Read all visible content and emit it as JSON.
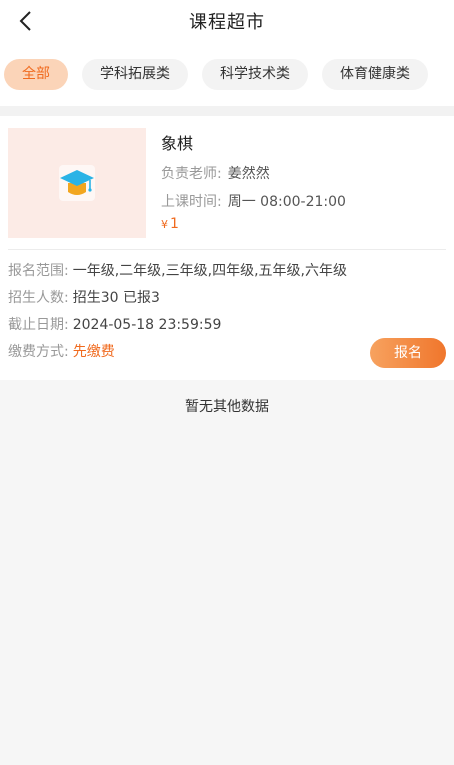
{
  "header": {
    "title": "课程超市",
    "back_icon": "chevron-left-icon"
  },
  "tabs": [
    {
      "label": "全部",
      "active": true
    },
    {
      "label": "学科拓展类",
      "active": false
    },
    {
      "label": "科学技术类",
      "active": false
    },
    {
      "label": "体育健康类",
      "active": false
    }
  ],
  "course": {
    "icon": "graduation-cap-icon",
    "name": "象棋",
    "teacher_label": "负责老师:",
    "teacher": "姜然然",
    "time_label": "上课时间:",
    "time": "周一 08:00-21:00",
    "price_symbol": "¥",
    "price": "1",
    "details": {
      "grades_label": "报名范围:",
      "grades": "一年级,二年级,三年级,四年级,五年级,六年级",
      "enroll_label": "招生人数:",
      "enroll": "招生30 已报3",
      "deadline_label": "截止日期:",
      "deadline": "2024-05-18 23:59:59",
      "pay_label": "缴费方式:",
      "pay": "先缴费"
    },
    "signup_label": "报名"
  },
  "empty_text": "暂无其他数据",
  "colors": {
    "accent": "#f06a1e",
    "tab_active_bg": "#fbd4b8",
    "thumb_bg": "#fcebe6"
  }
}
